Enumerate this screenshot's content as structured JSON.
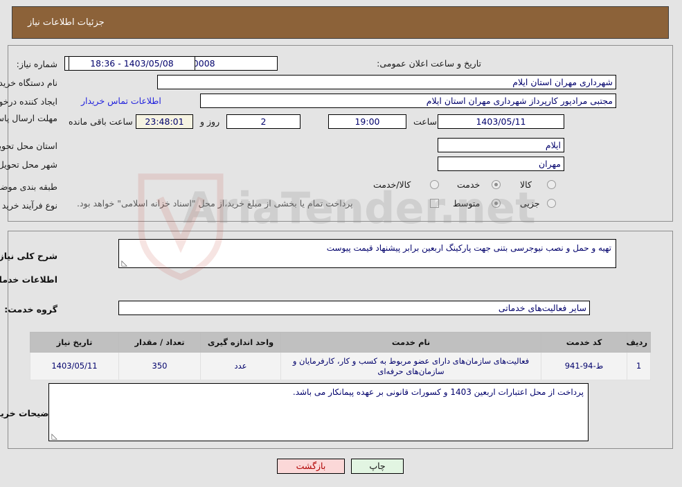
{
  "header": {
    "title": "جزئیات اطلاعات نیاز"
  },
  "form": {
    "need_number_label": "شماره نیاز:",
    "need_number_value": "1103004896000008",
    "announce_datetime_label": "تاریخ و ساعت اعلان عمومی:",
    "announce_datetime_value": "1403/05/08 - 18:36",
    "buyer_org_label": "نام دستگاه خریدار:",
    "buyer_org_value": "شهرداری مهران استان ایلام",
    "creator_label": "ایجاد کننده درخواست:",
    "creator_value": "مجتبی مرادپور کارپرداز شهرداری مهران استان ایلام",
    "contact_link": "اطلاعات تماس خریدار",
    "deadline_label": "مهلت ارسال پاسخ: تا تاریخ:",
    "deadline_date": "1403/05/11",
    "hour_label": "ساعت",
    "deadline_time": "19:00",
    "remaining_days": "2",
    "days_and_label": "روز و",
    "remaining_clock": "23:48:01",
    "remaining_suffix": "ساعت باقی مانده",
    "province_label": "استان محل تحویل:",
    "province_value": "ایلام",
    "city_label": "شهر محل تحویل:",
    "city_value": "مهران",
    "category_label": "طبقه بندی موضوعی:",
    "category_options": [
      {
        "label": "کالا",
        "selected": false
      },
      {
        "label": "خدمت",
        "selected": true
      },
      {
        "label": "کالا/خدمت",
        "selected": false
      }
    ],
    "process_label": "نوع فرآیند خرید :",
    "process_options": [
      {
        "label": "جزیی",
        "selected": false
      },
      {
        "label": "متوسط",
        "selected": true
      }
    ],
    "treasury_checkbox_text": "پرداخت تمام یا بخشی از مبلغ خرید،از محل \"اسناد خزانه اسلامی\" خواهد بود.",
    "treasury_checked": false
  },
  "middle": {
    "summary_label": "شرح کلی نیاز:",
    "summary_value": "تهیه و حمل و نصب نیوجرسی بتنی جهت پارکینگ اربعین برابر پیشنهاد قیمت پیوست",
    "services_heading": "اطلاعات خدمات مورد نیاز",
    "service_group_label": "گروه خدمت:",
    "service_group_value": "سایر فعالیت‌های خدماتی",
    "buyer_notes_label": "توضیحات خریدار:",
    "buyer_notes_value": "پرداخت از محل اعتبارات اربعین 1403 و کسورات قانونی بر عهده پیمانکار می باشد."
  },
  "table": {
    "columns": [
      "ردیف",
      "کد خدمت",
      "نام خدمت",
      "واحد اندازه گیری",
      "تعداد / مقدار",
      "تاریخ نیاز"
    ],
    "rows": [
      {
        "row_no": "1",
        "service_code": "ط-94-941",
        "service_name": "فعالیت‌های سازمان‌های دارای عضو مربوط به کسب و کار، کارفرمایان و سازمان‌های حرفه‌ای",
        "unit": "عدد",
        "quantity": "350",
        "need_date": "1403/05/11"
      }
    ]
  },
  "footer": {
    "print_label": "چاپ",
    "back_label": "بازگشت"
  },
  "watermark": {
    "text": "AriaTender.net"
  },
  "colors": {
    "header_bg": "#8c6239",
    "panel_border": "#8d8d8d",
    "link": "#2323dd",
    "input_text": "#00006b",
    "print_btn": "#e2f5e2",
    "back_btn": "#fbd8d8"
  }
}
